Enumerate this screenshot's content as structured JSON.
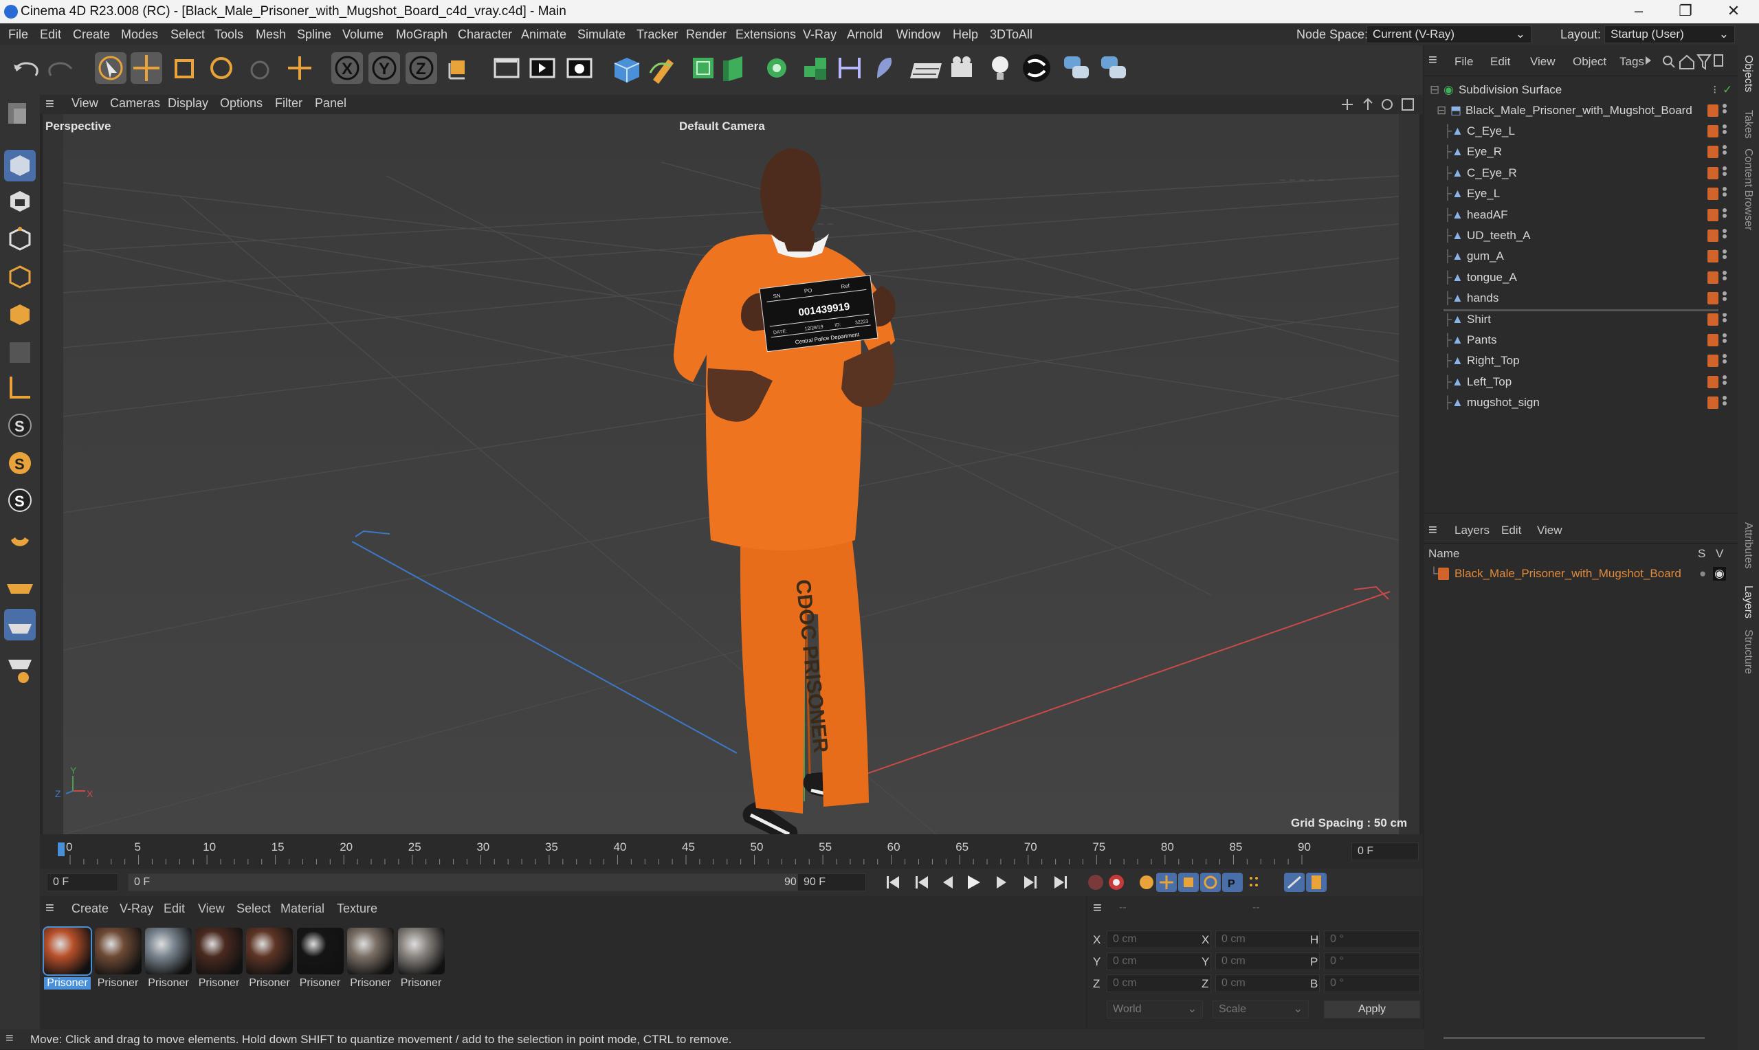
{
  "window": {
    "title": "Cinema 4D R23.008 (RC) - [Black_Male_Prisoner_with_Mugshot_Board_c4d_vray.c4d] - Main",
    "controls": [
      "–",
      "❐",
      "✕"
    ]
  },
  "menubar": {
    "items": [
      "File",
      "Edit",
      "Create",
      "Modes",
      "Select",
      "Tools",
      "Mesh",
      "Spline",
      "Volume",
      "MoGraph",
      "Character",
      "Animate",
      "Simulate",
      "Tracker",
      "Render",
      "Extensions",
      "V-Ray",
      "Arnold",
      "Window",
      "Help",
      "3DToAll"
    ],
    "node_space_label": "Node Space:",
    "node_space_value": "Current (V-Ray)",
    "layout_label": "Layout:",
    "layout_value": "Startup (User)"
  },
  "viewport": {
    "menu": [
      "View",
      "Cameras",
      "Display",
      "Options",
      "Filter",
      "Panel"
    ],
    "label": "Perspective",
    "camera": "Default Camera",
    "grid_spacing": "Grid Spacing : 50 cm",
    "axis_labels": [
      "Y",
      "Z",
      "X"
    ],
    "board_number": "001439919",
    "board_dept": "Central Police Department",
    "board_top": [
      "SN",
      "PO",
      "Ref"
    ],
    "board_date_label": "DATE:",
    "board_date": "12/28/19",
    "board_id_label": "ID:",
    "board_id": "32223",
    "pants_text": "CDOC PRISONER"
  },
  "timeline": {
    "ticks": [
      "0",
      "5",
      "10",
      "15",
      "20",
      "25",
      "30",
      "35",
      "40",
      "45",
      "50",
      "55",
      "60",
      "65",
      "70",
      "75",
      "80",
      "85",
      "90"
    ],
    "frame_end_field": "0 F"
  },
  "playbar": {
    "start_field": "0 F",
    "range_start": "0 F",
    "range_end": "90 F",
    "end_field": "90 F"
  },
  "materials": {
    "menu": [
      "Create",
      "V-Ray",
      "Edit",
      "View",
      "Select",
      "Material",
      "Texture"
    ],
    "items": [
      {
        "label": "Prisoner",
        "color": "#b8502a"
      },
      {
        "label": "Prisoner",
        "color": "#6e4a35"
      },
      {
        "label": "Prisoner",
        "color": "#7a8590"
      },
      {
        "label": "Prisoner",
        "color": "#4a2a20"
      },
      {
        "label": "Prisoner",
        "color": "#5e3526"
      },
      {
        "label": "Prisoner",
        "color": "#151515"
      },
      {
        "label": "Prisoner",
        "color": "#7b7066"
      },
      {
        "label": "Prisoner",
        "color": "#8a8580"
      }
    ]
  },
  "coordinates": {
    "header": [
      "--",
      "--"
    ],
    "rows": [
      {
        "a": "X",
        "av": "0 cm",
        "b": "X",
        "bv": "0 cm",
        "c": "H",
        "cv": "0 °"
      },
      {
        "a": "Y",
        "av": "0 cm",
        "b": "Y",
        "bv": "0 cm",
        "c": "P",
        "cv": "0 °"
      },
      {
        "a": "Z",
        "av": "0 cm",
        "b": "Z",
        "bv": "0 cm",
        "c": "B",
        "cv": "0 °"
      }
    ],
    "mode": "World",
    "scale": "Scale",
    "apply": "Apply"
  },
  "objects": {
    "menu": [
      "File",
      "Edit",
      "View",
      "Object",
      "Tags"
    ],
    "root": "Subdivision Surface",
    "group": "Black_Male_Prisoner_with_Mugshot_Board",
    "children": [
      "C_Eye_L",
      "Eye_R",
      "C_Eye_R",
      "Eye_L",
      "headAF",
      "UD_teeth_A",
      "gum_A",
      "tongue_A",
      "hands",
      "Shirt",
      "Pants",
      "Right_Top",
      "Left_Top",
      "mugshot_sign"
    ]
  },
  "layers": {
    "menu": [
      "Layers",
      "Edit",
      "View"
    ],
    "col_name": "Name",
    "col_s": "S",
    "col_v": "V",
    "items": [
      "Black_Male_Prisoner_with_Mugshot_Board"
    ]
  },
  "side_tabs": [
    "Objects",
    "Takes",
    "Content Browser",
    "Attributes",
    "Layers",
    "Structure"
  ],
  "status": "Move: Click and drag to move elements. Hold down SHIFT to quantize movement / add to the selection in point mode, CTRL to remove.",
  "colors": {
    "accent": "#4a90d9",
    "layer_orange": "#d0642a",
    "layer_text": "#e08a3c"
  }
}
